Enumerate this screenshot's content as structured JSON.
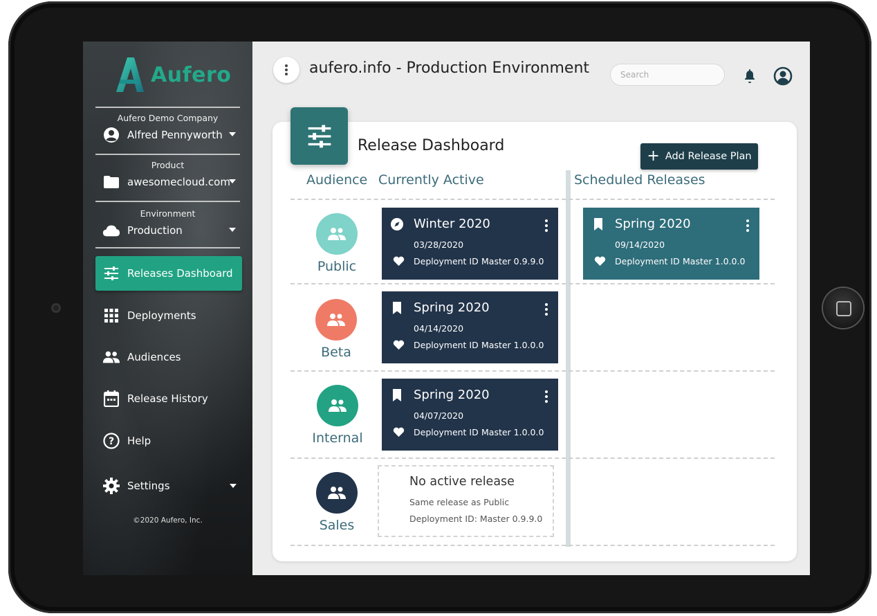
{
  "sidebar": {
    "logo_text": "Aufero",
    "company": {
      "caption": "Aufero Demo Company",
      "value": "Alfred Pennyworth"
    },
    "product": {
      "caption": "Product",
      "value": "awesomecloud.com"
    },
    "environment": {
      "caption": "Environment",
      "value": "Production"
    },
    "nav": [
      {
        "label": "Releases Dashboard",
        "icon": "sliders-icon",
        "active": true
      },
      {
        "label": "Deployments",
        "icon": "grid-icon"
      },
      {
        "label": "Audiences",
        "icon": "group-icon"
      },
      {
        "label": "Release History",
        "icon": "calendar-icon"
      },
      {
        "label": "Help",
        "icon": "help-icon"
      },
      {
        "label": "Settings",
        "icon": "gear-icon"
      }
    ],
    "copyright": "©2020 Aufero, Inc."
  },
  "header": {
    "title": "aufero.info - Production Environment",
    "search_placeholder": "Search"
  },
  "dashboard": {
    "title": "Release Dashboard",
    "add_button": "Add Release Plan",
    "columns": {
      "audience": "Audience",
      "active": "Currently Active",
      "scheduled": "Scheduled Releases"
    },
    "rows": [
      {
        "audience": "Public",
        "color": "#7fd3c8",
        "active": {
          "name": "Winter 2020",
          "date": "03/28/2020",
          "dep_label": "Deployment ID",
          "version": "Master 0.9.9.0",
          "icon": "compass-icon"
        },
        "scheduled": {
          "name": "Spring 2020",
          "date": "09/14/2020",
          "dep_label": "Deployment ID",
          "version": "Master 1.0.0.0",
          "icon": "bookmark-icon"
        }
      },
      {
        "audience": "Beta",
        "color": "#ef7b66",
        "active": {
          "name": "Spring 2020",
          "date": "04/14/2020",
          "dep_label": "Deployment ID",
          "version": "Master 1.0.0.0",
          "icon": "bookmark-icon"
        }
      },
      {
        "audience": "Internal",
        "color": "#23a383",
        "active": {
          "name": "Spring 2020",
          "date": "04/07/2020",
          "dep_label": "Deployment ID",
          "version": "Master 1.0.0.0",
          "icon": "bookmark-icon"
        }
      },
      {
        "audience": "Sales",
        "color": "#22344a",
        "empty": {
          "title": "No active release",
          "subtitle": "Same release as Public",
          "deployment": "Deployment ID: Master 0.9.9.0"
        }
      }
    ]
  }
}
